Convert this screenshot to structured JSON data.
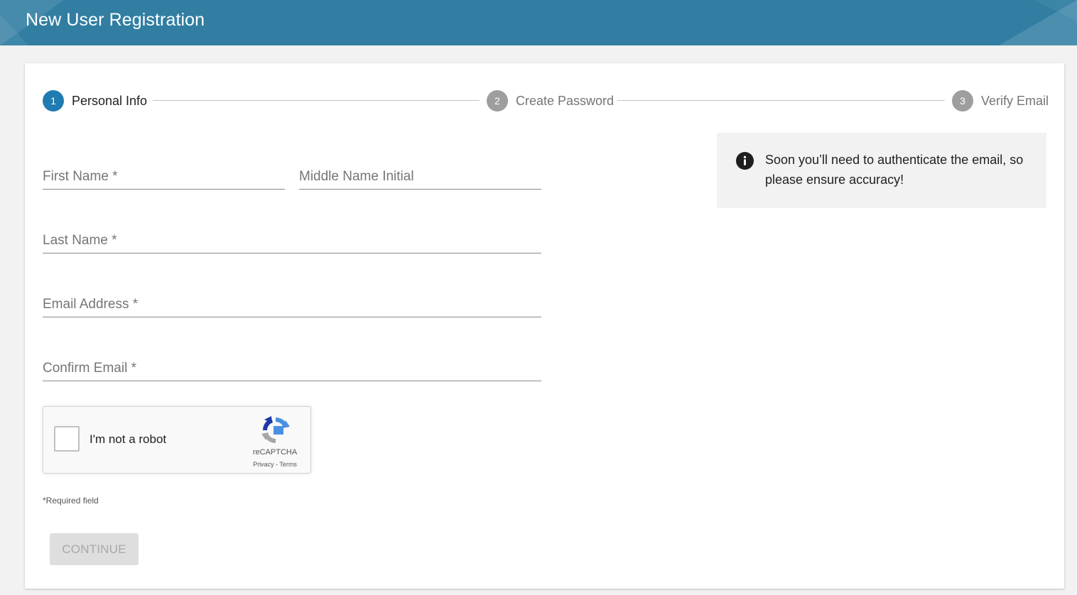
{
  "header": {
    "title": "New User Registration"
  },
  "stepper": {
    "steps": [
      {
        "number": "1",
        "label": "Personal Info",
        "active": true
      },
      {
        "number": "2",
        "label": "Create Password",
        "active": false
      },
      {
        "number": "3",
        "label": "Verify Email",
        "active": false
      }
    ]
  },
  "form": {
    "first_name": {
      "placeholder": "First Name *",
      "value": ""
    },
    "middle_initial": {
      "placeholder": "Middle Name Initial",
      "value": ""
    },
    "last_name": {
      "placeholder": "Last Name *",
      "value": ""
    },
    "email": {
      "placeholder": "Email Address *",
      "value": ""
    },
    "confirm_email": {
      "placeholder": "Confirm Email *",
      "value": ""
    }
  },
  "info": {
    "icon": "info-icon",
    "message": "Soon you’ll need to authenticate the email, so please ensure accuracy!"
  },
  "recaptcha": {
    "label": "I'm not a robot",
    "brand": "reCAPTCHA",
    "privacy": "Privacy",
    "separator": " - ",
    "terms": "Terms",
    "checked": false
  },
  "required_note": "*Required field",
  "continue_label": "CONTINUE",
  "colors": {
    "header": "#317ea2",
    "active_step": "#1f7bb0",
    "inactive_step": "#9e9e9e",
    "button_disabled_bg": "#dedede",
    "button_disabled_text": "#a8a8a8"
  }
}
